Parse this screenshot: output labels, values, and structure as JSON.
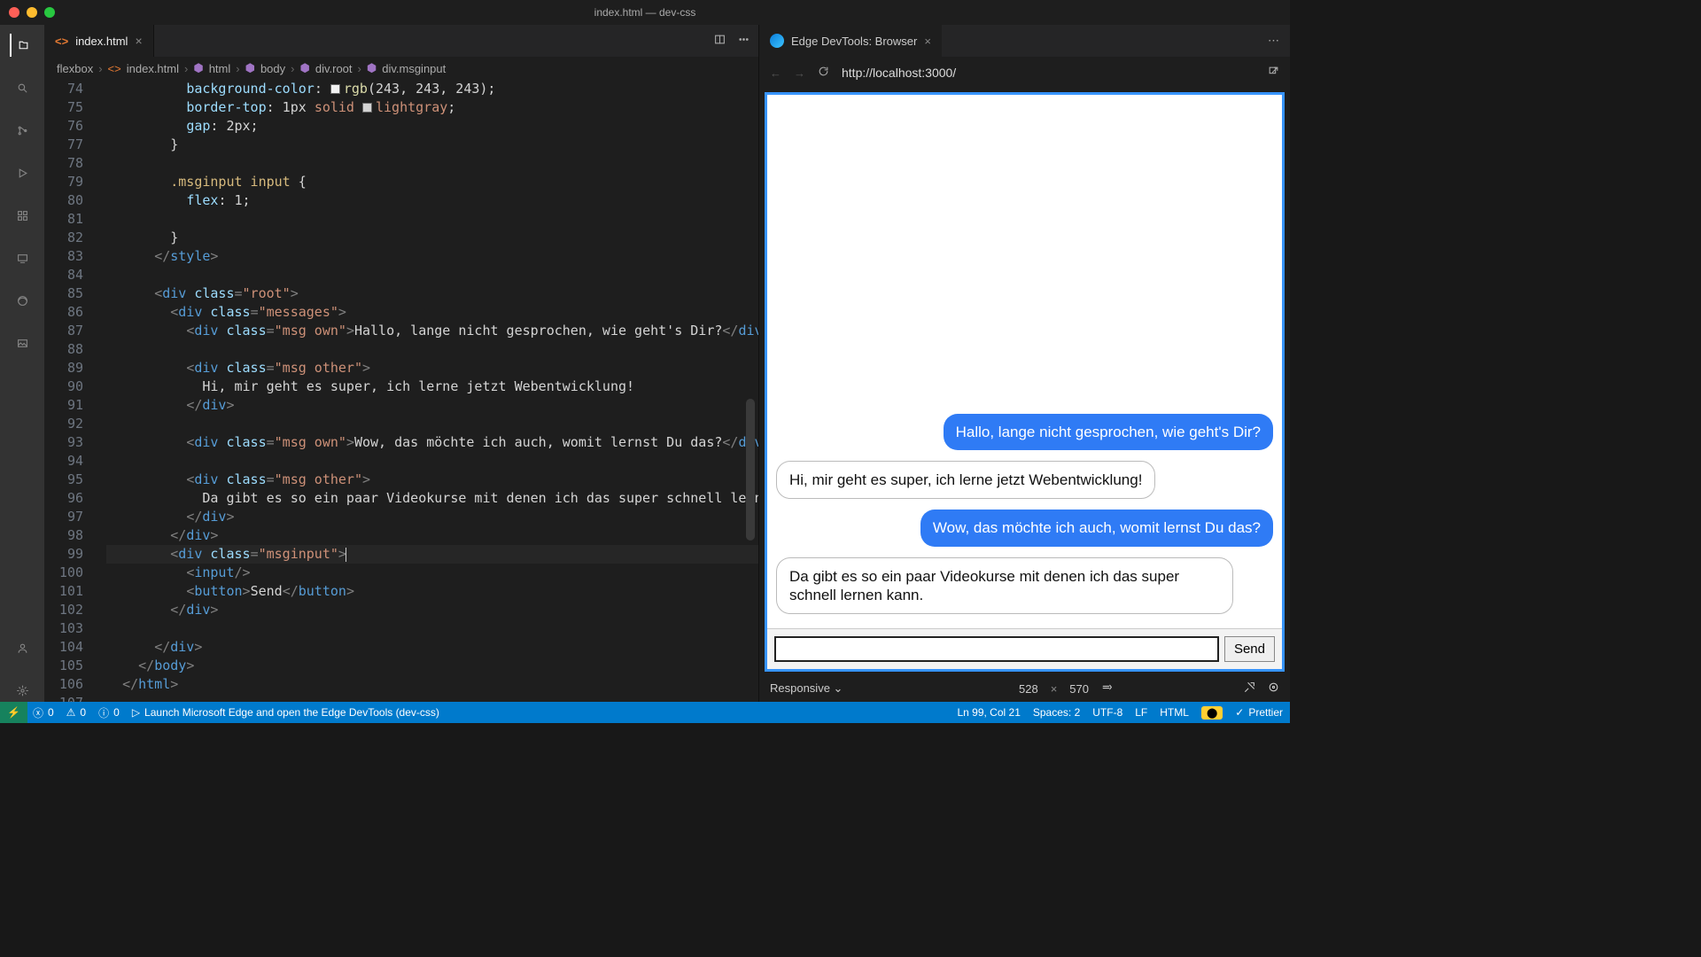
{
  "window": {
    "title": "index.html — dev-css"
  },
  "tab": {
    "filename": "index.html"
  },
  "breadcrumbs": [
    "flexbox",
    "index.html",
    "html",
    "body",
    "div.root",
    "div.msginput"
  ],
  "lines": {
    "start": 74,
    "count": 34
  },
  "code_text": {
    "msg1": "Hallo, lange nicht gesprochen, wie geht's Dir?",
    "msg2": "Hi, mir geht es super, ich lerne jetzt Webentwicklung!",
    "msg3": "Wow, das möchte ich auch, womit lernst Du das?",
    "msg4_a": "Da gibt es so ein paar Videokurse mit denen ich das super schnell lernen ka",
    "send": "Send"
  },
  "preview_tab": {
    "label": "Edge DevTools: Browser"
  },
  "url": "http://localhost:3000/",
  "chat": {
    "m1": "Hallo, lange nicht gesprochen, wie geht's Dir?",
    "m2": "Hi, mir geht es super, ich lerne jetzt Webentwicklung!",
    "m3": "Wow, das möchte ich auch, womit lernst Du das?",
    "m4": "Da gibt es so ein paar Videokurse mit denen ich das super schnell lernen kann.",
    "send": "Send"
  },
  "devbar": {
    "mode": "Responsive",
    "w": "528",
    "h": "570"
  },
  "status": {
    "errors": "0",
    "warnings": "0",
    "info": "0",
    "launch": "Launch Microsoft Edge and open the Edge DevTools (dev-css)",
    "pos": "Ln 99, Col 21",
    "spaces": "Spaces: 2",
    "enc": "UTF-8",
    "eol": "LF",
    "lang": "HTML",
    "prettier": "Prettier"
  }
}
